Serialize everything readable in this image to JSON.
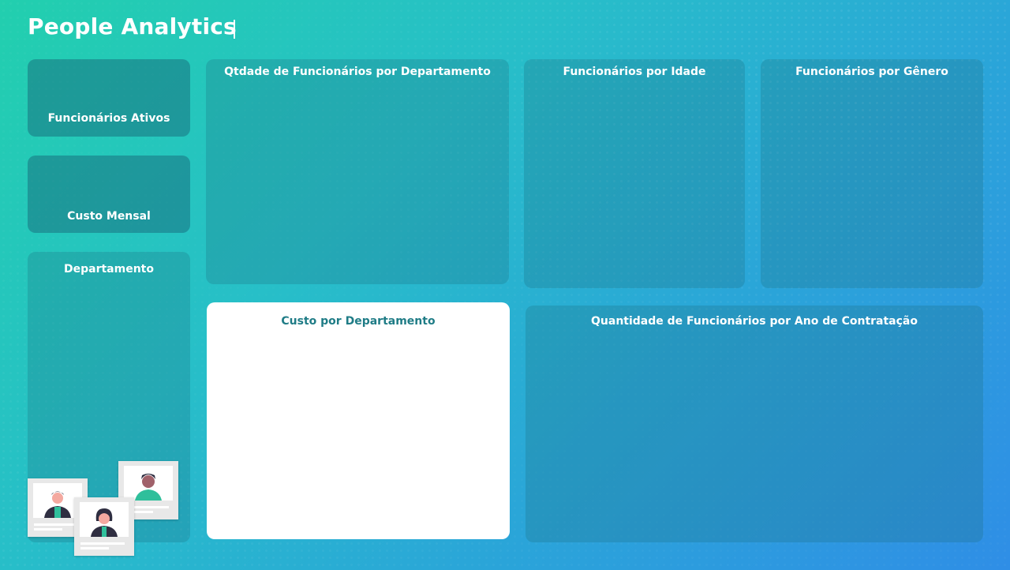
{
  "header": {
    "title": "People Analytics"
  },
  "kpis": {
    "active_employees_label": "Funcionários Ativos",
    "monthly_cost_label": "Custo Mensal"
  },
  "filters": {
    "department_label": "Departamento"
  },
  "charts": {
    "dept_count_title": "Qtdade de Funcionários por Departamento",
    "age_title": "Funcionários por Idade",
    "gender_title": "Funcionários por Gênero",
    "dept_cost_title": "Custo por Departamento",
    "hire_year_title": "Quantidade de Funcionários por Ano de Contratação"
  },
  "colors": {
    "accent_teal": "#1f7c86",
    "person_shirt": "#2fbf9b",
    "person_dark": "#2f2e41"
  },
  "illustration": {
    "icon": "employee-photos-illustration"
  }
}
